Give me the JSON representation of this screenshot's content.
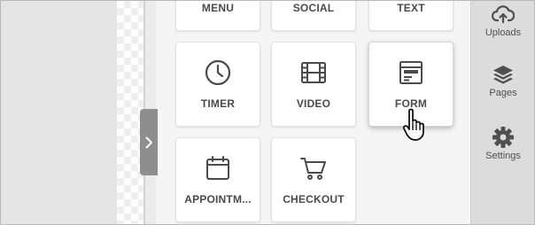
{
  "collapse_handle": {
    "icon": "chevron-right-icon"
  },
  "widgets": {
    "top_row": [
      {
        "label": "MENU"
      },
      {
        "label": "SOCIAL"
      },
      {
        "label": "TEXT"
      }
    ],
    "timer": {
      "label": "TIMER",
      "icon": "clock-icon"
    },
    "video": {
      "label": "VIDEO",
      "icon": "film-icon"
    },
    "form": {
      "label": "FORM",
      "icon": "form-icon"
    },
    "appointment": {
      "label": "APPOINTM...",
      "icon": "calendar-icon"
    },
    "checkout": {
      "label": "CHECKOUT",
      "icon": "shopping-cart-icon"
    }
  },
  "sidebar": {
    "uploads": {
      "label": "Uploads",
      "icon": "cloud-upload-icon"
    },
    "pages": {
      "label": "Pages",
      "icon": "layers-icon"
    },
    "settings": {
      "label": "Settings",
      "icon": "gear-icon"
    }
  },
  "cursor": {
    "icon": "hand-pointer-icon"
  },
  "colors": {
    "icon": "#4a4a4a",
    "panel": "#f5f5f5",
    "sidebar": "#dcdcdc",
    "handle": "#8e8e8e"
  }
}
